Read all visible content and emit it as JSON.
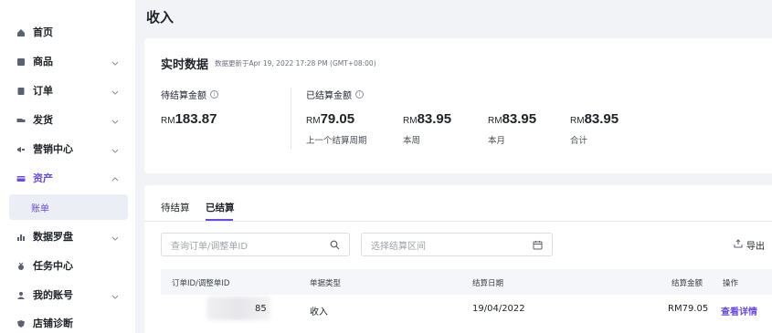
{
  "sidebar": {
    "items": [
      {
        "label": "首页",
        "icon": "home-icon"
      },
      {
        "label": "商品",
        "icon": "product-icon"
      },
      {
        "label": "订单",
        "icon": "order-icon"
      },
      {
        "label": "发货",
        "icon": "truck-icon"
      },
      {
        "label": "营销中心",
        "icon": "megaphone-icon"
      },
      {
        "label": "资产",
        "icon": "wallet-icon"
      },
      {
        "label": "数据罗盘",
        "icon": "bar-chart-icon"
      },
      {
        "label": "任务中心",
        "icon": "medal-icon"
      },
      {
        "label": "我的账号",
        "icon": "user-icon"
      },
      {
        "label": "店铺诊断",
        "icon": "shield-icon"
      }
    ],
    "sub_item": "账单",
    "accent": "#6a4ddb"
  },
  "page": {
    "title": "收入"
  },
  "realtime": {
    "title": "实时数据",
    "updated": "数据更新于Apr 19, 2022 17:28 PM (GMT+08:00)",
    "pending_label": "待结算金额",
    "pending_currency": "RM",
    "pending_amount": "183.87",
    "settled_label": "已结算金额",
    "settled": [
      {
        "currency": "RM",
        "amount": "79.05",
        "caption": "上一个结算周期"
      },
      {
        "currency": "RM",
        "amount": "83.95",
        "caption": "本周"
      },
      {
        "currency": "RM",
        "amount": "83.95",
        "caption": "本月"
      },
      {
        "currency": "RM",
        "amount": "83.95",
        "caption": "合计"
      }
    ]
  },
  "tabs": [
    {
      "label": "待结算"
    },
    {
      "label": "已结算"
    }
  ],
  "filters": {
    "search_placeholder": "查询订单/调整单ID",
    "date_placeholder": "选择结算区间",
    "export_label": "导出"
  },
  "table": {
    "headers": [
      "订单ID/调整单ID",
      "单据类型",
      "结算日期",
      "结算金额",
      "操作"
    ],
    "rows": [
      {
        "id_suffix": "85",
        "type": "收入",
        "date": "19/04/2022",
        "amount": "RM79.05",
        "action": "查看详情"
      }
    ]
  }
}
